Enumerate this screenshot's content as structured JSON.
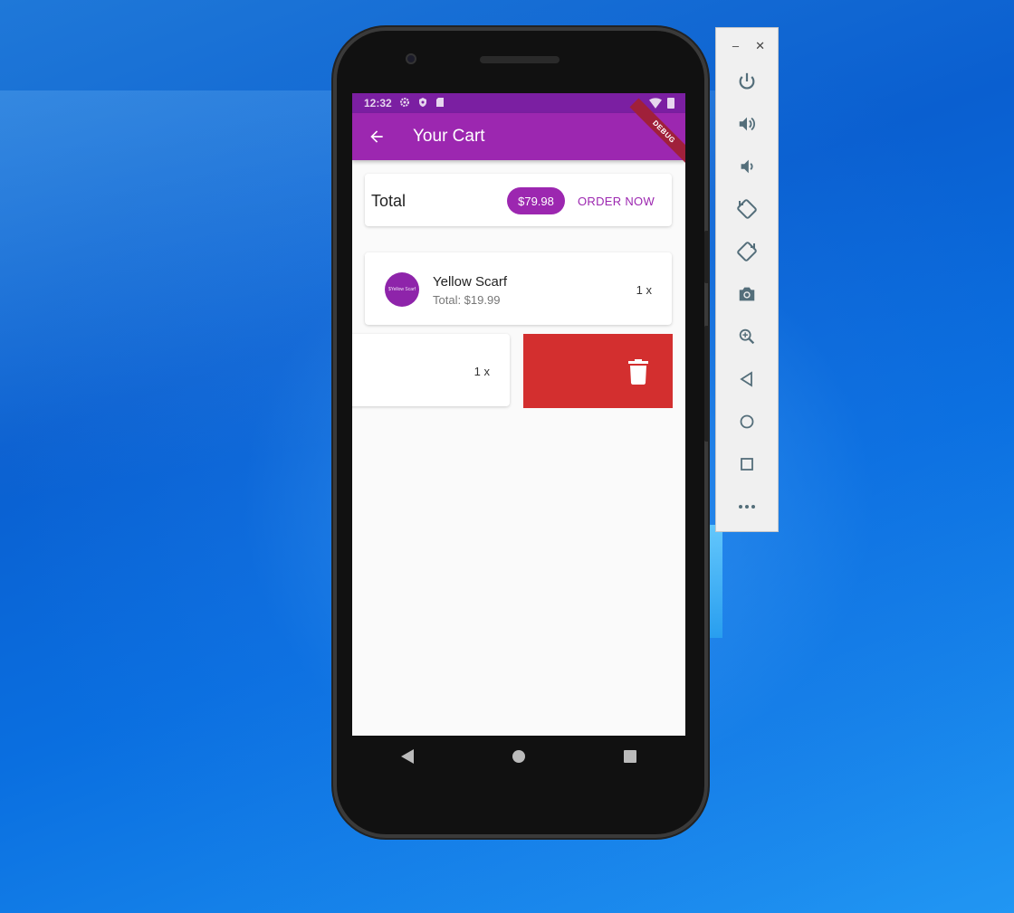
{
  "status_bar": {
    "time": "12:32"
  },
  "app_bar": {
    "title": "Your Cart",
    "debug_banner": "DEBUG"
  },
  "total_card": {
    "label": "Total",
    "amount": "$79.98",
    "order_button": "ORDER NOW"
  },
  "cart_items": [
    {
      "avatar_text": "$Yellow Scarf",
      "title": "Yellow Scarf",
      "subtitle": "Total: $19.99",
      "quantity": "1 x"
    },
    {
      "quantity": "1 x"
    }
  ],
  "colors": {
    "primary": "#9c27b0",
    "status_bar": "#7b1fa2",
    "delete": "#d32f2f"
  },
  "emulator_toolbar": {
    "window_controls": [
      "minimize-icon",
      "close-icon"
    ],
    "buttons": [
      "power-icon",
      "volume-up-icon",
      "volume-down-icon",
      "rotate-left-icon",
      "rotate-right-icon",
      "camera-icon",
      "zoom-icon",
      "back-icon",
      "home-icon",
      "overview-icon",
      "more-icon"
    ]
  }
}
